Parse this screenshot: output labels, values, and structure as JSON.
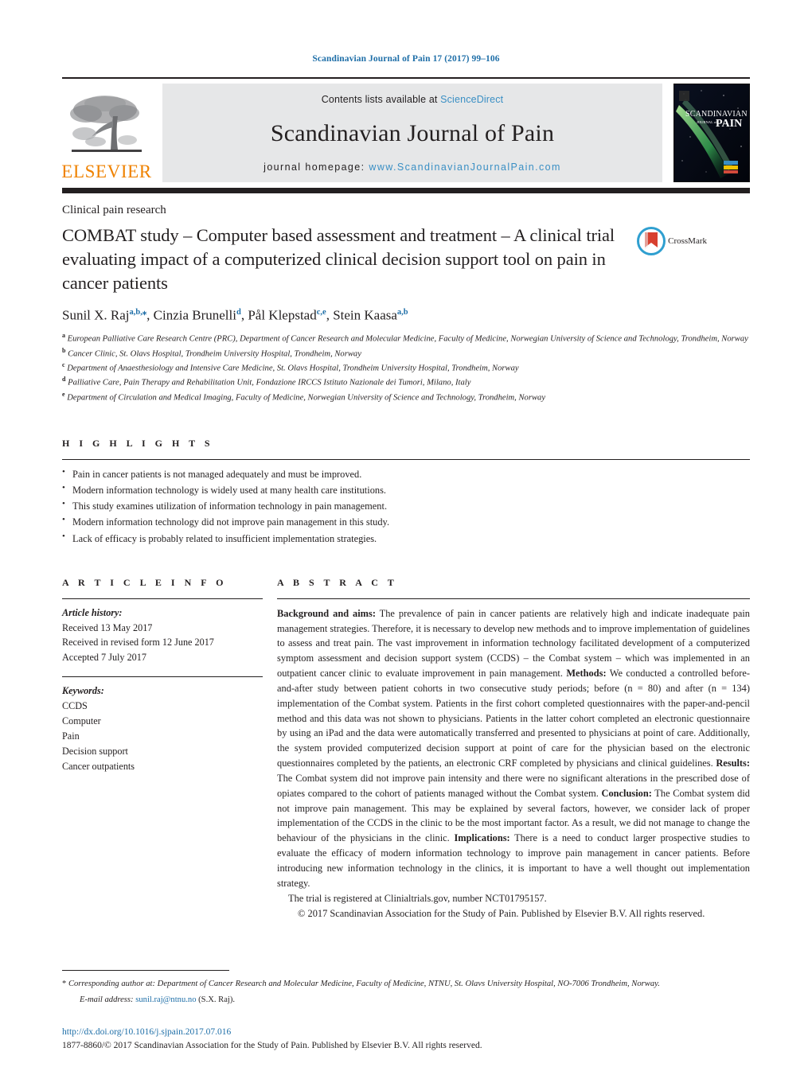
{
  "running_head": "Scandinavian Journal of Pain 17 (2017) 99–106",
  "masthead": {
    "contents_prefix": "Contents lists available at ",
    "sciencedirect": "ScienceDirect",
    "journal_name": "Scandinavian Journal of Pain",
    "homepage_prefix": "journal homepage: ",
    "homepage_url": "www.ScandinavianJournalPain.com",
    "publisher_name": "ELSEVIER",
    "cover_title_1": "SCANDINAVIAN",
    "cover_title_2": "PAIN",
    "cover_title_small": "JOURNAL of"
  },
  "article": {
    "section_label": "Clinical pain research",
    "title": "COMBAT study – Computer based assessment and treatment – A clinical trial evaluating impact of a computerized clinical decision support tool on pain in cancer patients",
    "crossmark_label": "CrossMark",
    "authors": [
      {
        "name": "Sunil X. Raj",
        "sup": "a,b,⁎"
      },
      {
        "name": "Cinzia Brunelli",
        "sup": "d"
      },
      {
        "name": "Pål Klepstad",
        "sup": "c,e"
      },
      {
        "name": "Stein Kaasa",
        "sup": "a,b"
      }
    ],
    "affiliations": [
      {
        "marker": "a",
        "text": "European Palliative Care Research Centre (PRC), Department of Cancer Research and Molecular Medicine, Faculty of Medicine, Norwegian University of Science and Technology, Trondheim, Norway"
      },
      {
        "marker": "b",
        "text": "Cancer Clinic, St. Olavs Hospital, Trondheim University Hospital, Trondheim, Norway"
      },
      {
        "marker": "c",
        "text": "Department of Anaesthesiology and Intensive Care Medicine, St. Olavs Hospital, Trondheim University Hospital, Trondheim, Norway"
      },
      {
        "marker": "d",
        "text": "Palliative Care, Pain Therapy and Rehabilitation Unit, Fondazione IRCCS Istituto Nazionale dei Tumori, Milano, Italy"
      },
      {
        "marker": "e",
        "text": "Department of Circulation and Medical Imaging, Faculty of Medicine, Norwegian University of Science and Technology, Trondheim, Norway"
      }
    ]
  },
  "highlights": {
    "heading": "H I G H L I G H T S",
    "items": [
      "Pain in cancer patients is not managed adequately and must be improved.",
      "Modern information technology is widely used at many health care institutions.",
      "This study examines utilization of information technology in pain management.",
      "Modern information technology did not improve pain management in this study.",
      "Lack of efficacy is probably related to insufficient implementation strategies."
    ]
  },
  "article_info": {
    "heading": "A R T I C L E   I N F O",
    "history_label": "Article history:",
    "history": [
      "Received 13 May 2017",
      "Received in revised form 12 June 2017",
      "Accepted 7 July 2017"
    ],
    "keywords_label": "Keywords:",
    "keywords": [
      "CCDS",
      "Computer",
      "Pain",
      "Decision support",
      "Cancer outpatients"
    ]
  },
  "abstract": {
    "heading": "A B S T R A C T",
    "sections": [
      {
        "label": "Background and aims:",
        "text": " The prevalence of pain in cancer patients are relatively high and indicate inadequate pain management strategies. Therefore, it is necessary to develop new methods and to improve implementation of guidelines to assess and treat pain. The vast improvement in information technology facilitated development of a computerized symptom assessment and decision support system (CCDS) – the Combat system – which was implemented in an outpatient cancer clinic to evaluate improvement in pain management."
      },
      {
        "label": "Methods:",
        "text": " We conducted a controlled before-and-after study between patient cohorts in two consecutive study periods; before (n = 80) and after (n = 134) implementation of the Combat system. Patients in the first cohort completed questionnaires with the paper-and-pencil method and this data was not shown to physicians. Patients in the latter cohort completed an electronic questionnaire by using an iPad and the data were automatically transferred and presented to physicians at point of care. Additionally, the system provided computerized decision support at point of care for the physician based on the electronic questionnaires completed by the patients, an electronic CRF completed by physicians and clinical guidelines."
      },
      {
        "label": "Results:",
        "text": " The Combat system did not improve pain intensity and there were no significant alterations in the prescribed dose of opiates compared to the cohort of patients managed without the Combat system."
      },
      {
        "label": "Conclusion:",
        "text": " The Combat system did not improve pain management. This may be explained by several factors, however, we consider lack of proper implementation of the CCDS in the clinic to be the most important factor. As a result, we did not manage to change the behaviour of the physicians in the clinic."
      },
      {
        "label": "Implications:",
        "text": " There is a need to conduct larger prospective studies to evaluate the efficacy of modern information technology to improve pain management in cancer patients. Before introducing new information technology in the clinics, it is important to have a well thought out implementation strategy."
      }
    ],
    "trial_line": "The trial is registered at Clinialtrials.gov, number NCT01795157.",
    "copyright_line": "© 2017 Scandinavian Association for the Study of Pain. Published by Elsevier B.V. All rights reserved."
  },
  "footer": {
    "corresponding_star": "*",
    "corresponding_text": " Corresponding author at: Department of Cancer Research and Molecular Medicine, Faculty of Medicine, NTNU, St. Olavs University Hospital, NO-7006 Trondheim, Norway.",
    "email_label": "E-mail address:",
    "email": "sunil.raj@ntnu.no",
    "email_suffix": " (S.X. Raj).",
    "doi": "http://dx.doi.org/10.1016/j.sjpain.2017.07.016",
    "issn_line": "1877-8860/© 2017 Scandinavian Association for the Study of Pain. Published by Elsevier B.V. All rights reserved."
  },
  "colors": {
    "link_blue": "#1f6fa8",
    "sciencedirect_blue": "#3a8fc4",
    "elsevier_orange": "#ef8200",
    "rule_black": "#231f20",
    "masthead_grey": "#e6e7e8"
  }
}
